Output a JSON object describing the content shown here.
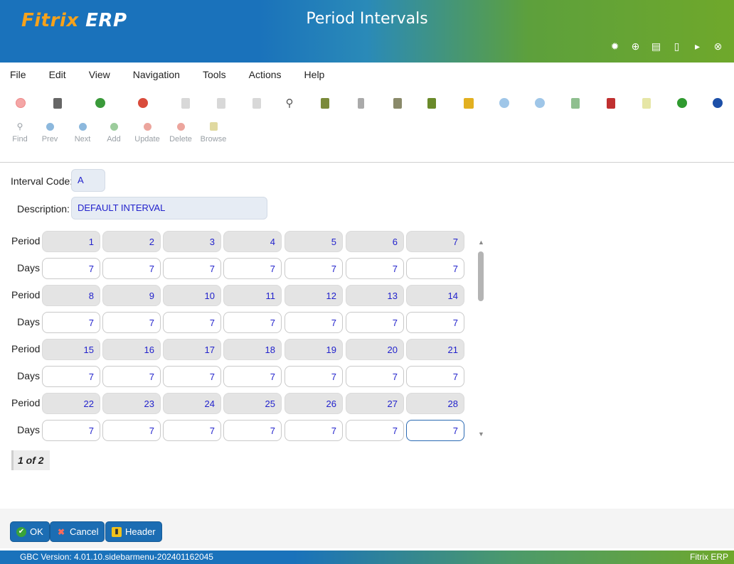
{
  "app": {
    "logo": "ERP",
    "logo_brand": "Fitrix",
    "window_title": "Period Intervals"
  },
  "titlebar_icons": [
    "gear-icon",
    "chip-icon",
    "document-icon",
    "new-document-icon",
    "play-icon",
    "close-icon"
  ],
  "menu": [
    "File",
    "Edit",
    "View",
    "Navigation",
    "Tools",
    "Actions",
    "Help"
  ],
  "toolbar2": [
    {
      "label": "Find",
      "icon": "search-icon"
    },
    {
      "label": "Prev",
      "icon": "prev-icon"
    },
    {
      "label": "Next",
      "icon": "next-icon"
    },
    {
      "label": "Add",
      "icon": "add-icon"
    },
    {
      "label": "Update",
      "icon": "update-icon"
    },
    {
      "label": "Delete",
      "icon": "delete-icon"
    },
    {
      "label": "Browse",
      "icon": "browse-icon"
    }
  ],
  "form": {
    "interval_code_label": "Interval Code:",
    "interval_code_value": "A",
    "description_label": "Description:",
    "description_value": "DEFAULT INTERVAL"
  },
  "grid": {
    "period_label": "Period",
    "days_label": "Days",
    "rows": [
      {
        "periods": [
          "1",
          "2",
          "3",
          "4",
          "5",
          "6",
          "7"
        ],
        "days": [
          "7",
          "7",
          "7",
          "7",
          "7",
          "7",
          "7"
        ]
      },
      {
        "periods": [
          "8",
          "9",
          "10",
          "11",
          "12",
          "13",
          "14"
        ],
        "days": [
          "7",
          "7",
          "7",
          "7",
          "7",
          "7",
          "7"
        ]
      },
      {
        "periods": [
          "15",
          "16",
          "17",
          "18",
          "19",
          "20",
          "21"
        ],
        "days": [
          "7",
          "7",
          "7",
          "7",
          "7",
          "7",
          "7"
        ]
      },
      {
        "periods": [
          "22",
          "23",
          "24",
          "25",
          "26",
          "27",
          "28"
        ],
        "days": [
          "7",
          "7",
          "7",
          "7",
          "7",
          "7",
          "7"
        ]
      }
    ]
  },
  "pager": "1 of 2",
  "buttons": {
    "ok": "OK",
    "cancel": "Cancel",
    "header": "Header"
  },
  "status": {
    "version": "GBC Version: 4.01.10.sidebarmenu-202401162045",
    "brand": "Fitrix ERP"
  }
}
